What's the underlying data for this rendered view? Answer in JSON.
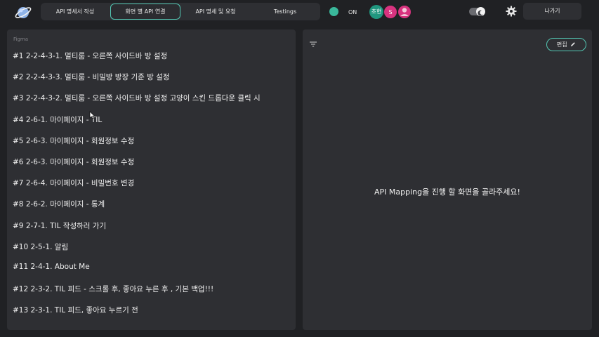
{
  "header": {
    "tabs": [
      {
        "label": "API 명세서 작성",
        "active": false
      },
      {
        "label": "화면 별 API 연결",
        "active": true
      },
      {
        "label": "API 명세 및 요청",
        "active": false
      },
      {
        "label": "Testings",
        "active": false
      }
    ],
    "status_label": "ON",
    "avatars": [
      {
        "text": "초현",
        "color": "#20977f"
      },
      {
        "text": "S",
        "color": "#d8337f"
      },
      {
        "text": "",
        "color": "#d8337f",
        "icon": "user-icon"
      }
    ],
    "exit_label": "나가기",
    "accent": "#53c7b3"
  },
  "left_panel": {
    "label": "Figma",
    "screens": [
      "#1 2-2-4-3-1. 멀티룸 - 오른쪽 사이드바 방 설정",
      "#2 2-2-4-3-3. 멀티룸 - 비밀방 방장 기준 방 설정",
      "#3 2-2-4-3-2. 멀티룸 - 오른쪽 사이드바 방 설정 고양이 스킨 드롭다운 클릭 시",
      "#4 2-6-1. 마이페이지 - TIL",
      "#5 2-6-3. 마이페이지 - 회원정보 수정",
      "#6 2-6-3. 마이페이지 - 회원정보 수정",
      "#7 2-6-4. 마이페이지 - 비밀번호 변경",
      "#8 2-6-2. 마이페이지 - 통계",
      "#9 2-7-1. TIL 작성하러 가기",
      "#10 2-5-1. 알림",
      "#11 2-4-1. About Me",
      "#12 2-3-2. TIL 피드 - 스크롤 후, 좋아요 누른 후 , 기본 백업!!!",
      "#13 2-3-1. TIL 피드, 좋아요 누르기 전"
    ]
  },
  "right_panel": {
    "edit_label": "편집",
    "placeholder": "API Mapping을 진행 할 화면을 골라주세요!"
  }
}
